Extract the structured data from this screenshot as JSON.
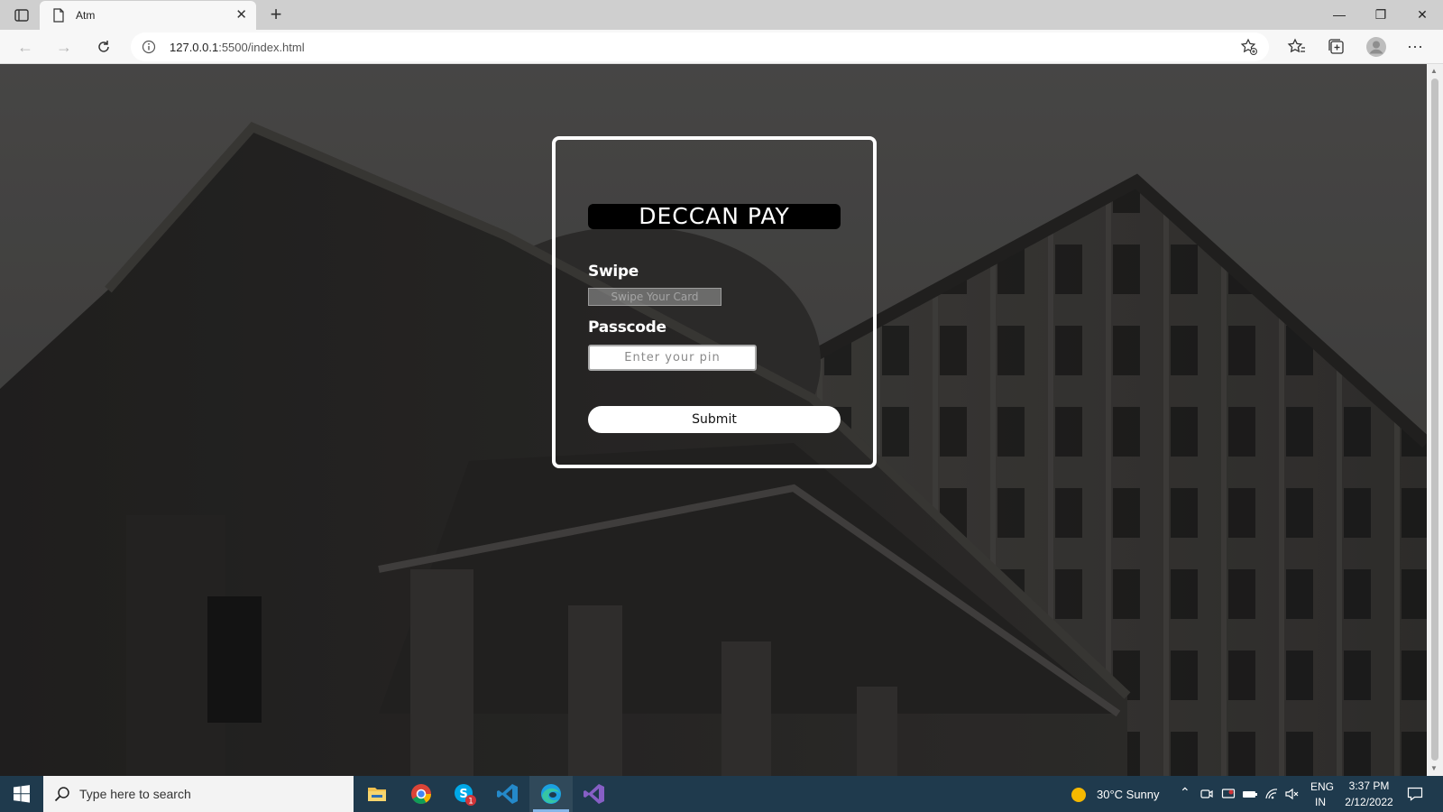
{
  "browser": {
    "tab_title": "Atm",
    "url_host": "127.0.0.1",
    "url_path": ":5500/index.html"
  },
  "card": {
    "brand": "DECCAN PAY",
    "swipe_label": "Swipe",
    "swipe_placeholder": "Swipe Your Card",
    "passcode_label": "Passcode",
    "passcode_placeholder": "Enter your pin",
    "submit_label": "Submit"
  },
  "taskbar": {
    "search_placeholder": "Type here to search",
    "weather": "30°C  Sunny",
    "lang_top": "ENG",
    "lang_bottom": "IN",
    "time": "3:37 PM",
    "date": "2/12/2022",
    "skype_badge": "1"
  },
  "colors": {
    "taskbar": "#1f3a4d",
    "tab_bar": "#cfcfcf",
    "card_border": "#ffffff",
    "brand_bg": "#000000"
  }
}
